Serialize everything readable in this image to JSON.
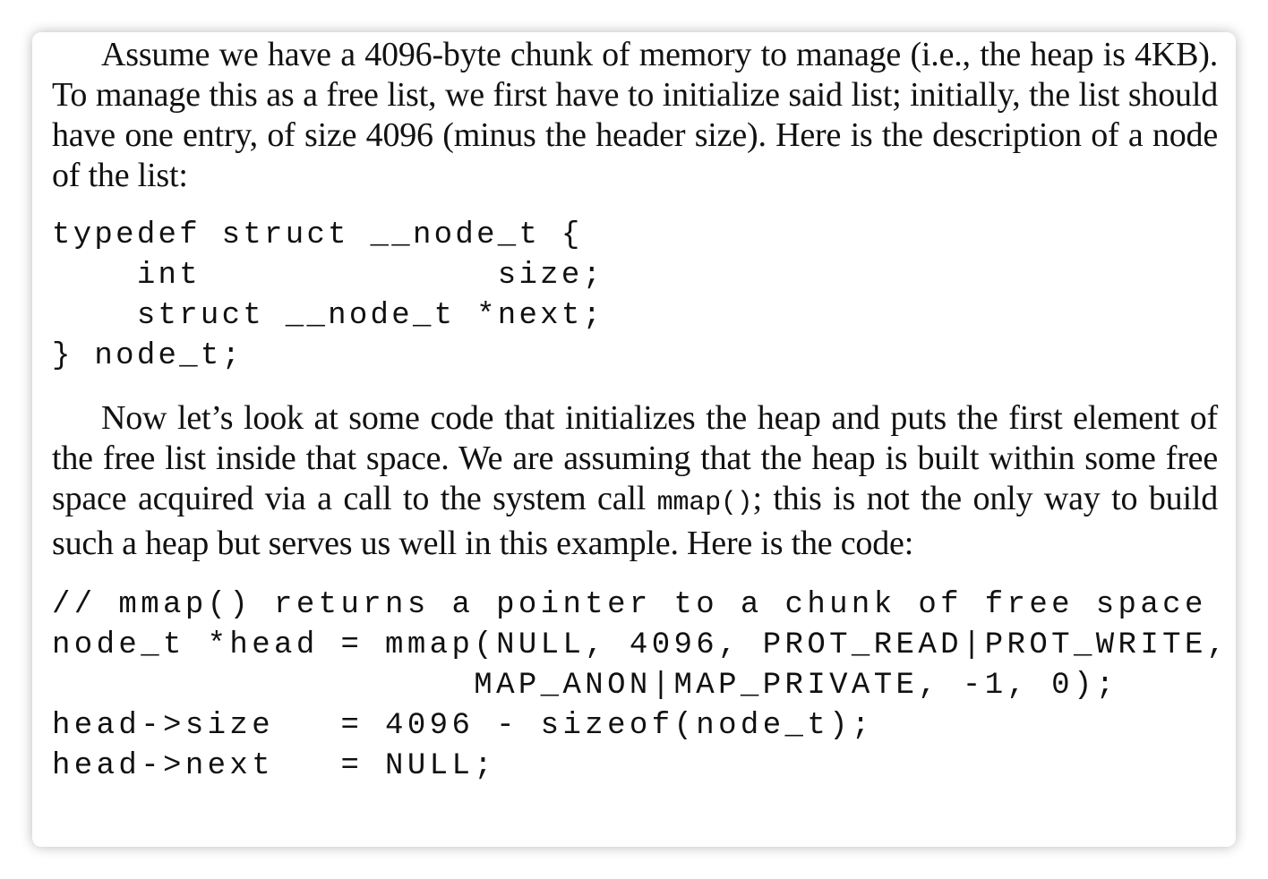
{
  "paragraph1": {
    "text": "Assume we have a 4096-byte chunk of memory to manage (i.e., the heap is 4KB). To manage this as a free list, we first have to initialize said list; initially, the list should have one entry, of size 4096 (minus the header size). Here is the description of a node of the list:"
  },
  "code1": {
    "lines": [
      "typedef struct __node_t {",
      "    int              size;",
      "    struct __node_t *next;",
      "} node_t;"
    ]
  },
  "paragraph2": {
    "text_before": "Now let’s look at some code that initializes the heap and puts the first element of the free list inside that space. We are assuming that the heap is built within some free space acquired via a call to the system call ",
    "code_inline": "mmap()",
    "text_after": "; this is not the only way to build such a heap but serves us well in this example. Here is the code:"
  },
  "code2": {
    "lines": [
      "// mmap() returns a pointer to a chunk of free space",
      "node_t *head = mmap(NULL, 4096, PROT_READ|PROT_WRITE,",
      "                   MAP_ANON|MAP_PRIVATE, -1, 0);",
      "head->size   = 4096 - sizeof(node_t);",
      "head->next   = NULL;"
    ]
  }
}
